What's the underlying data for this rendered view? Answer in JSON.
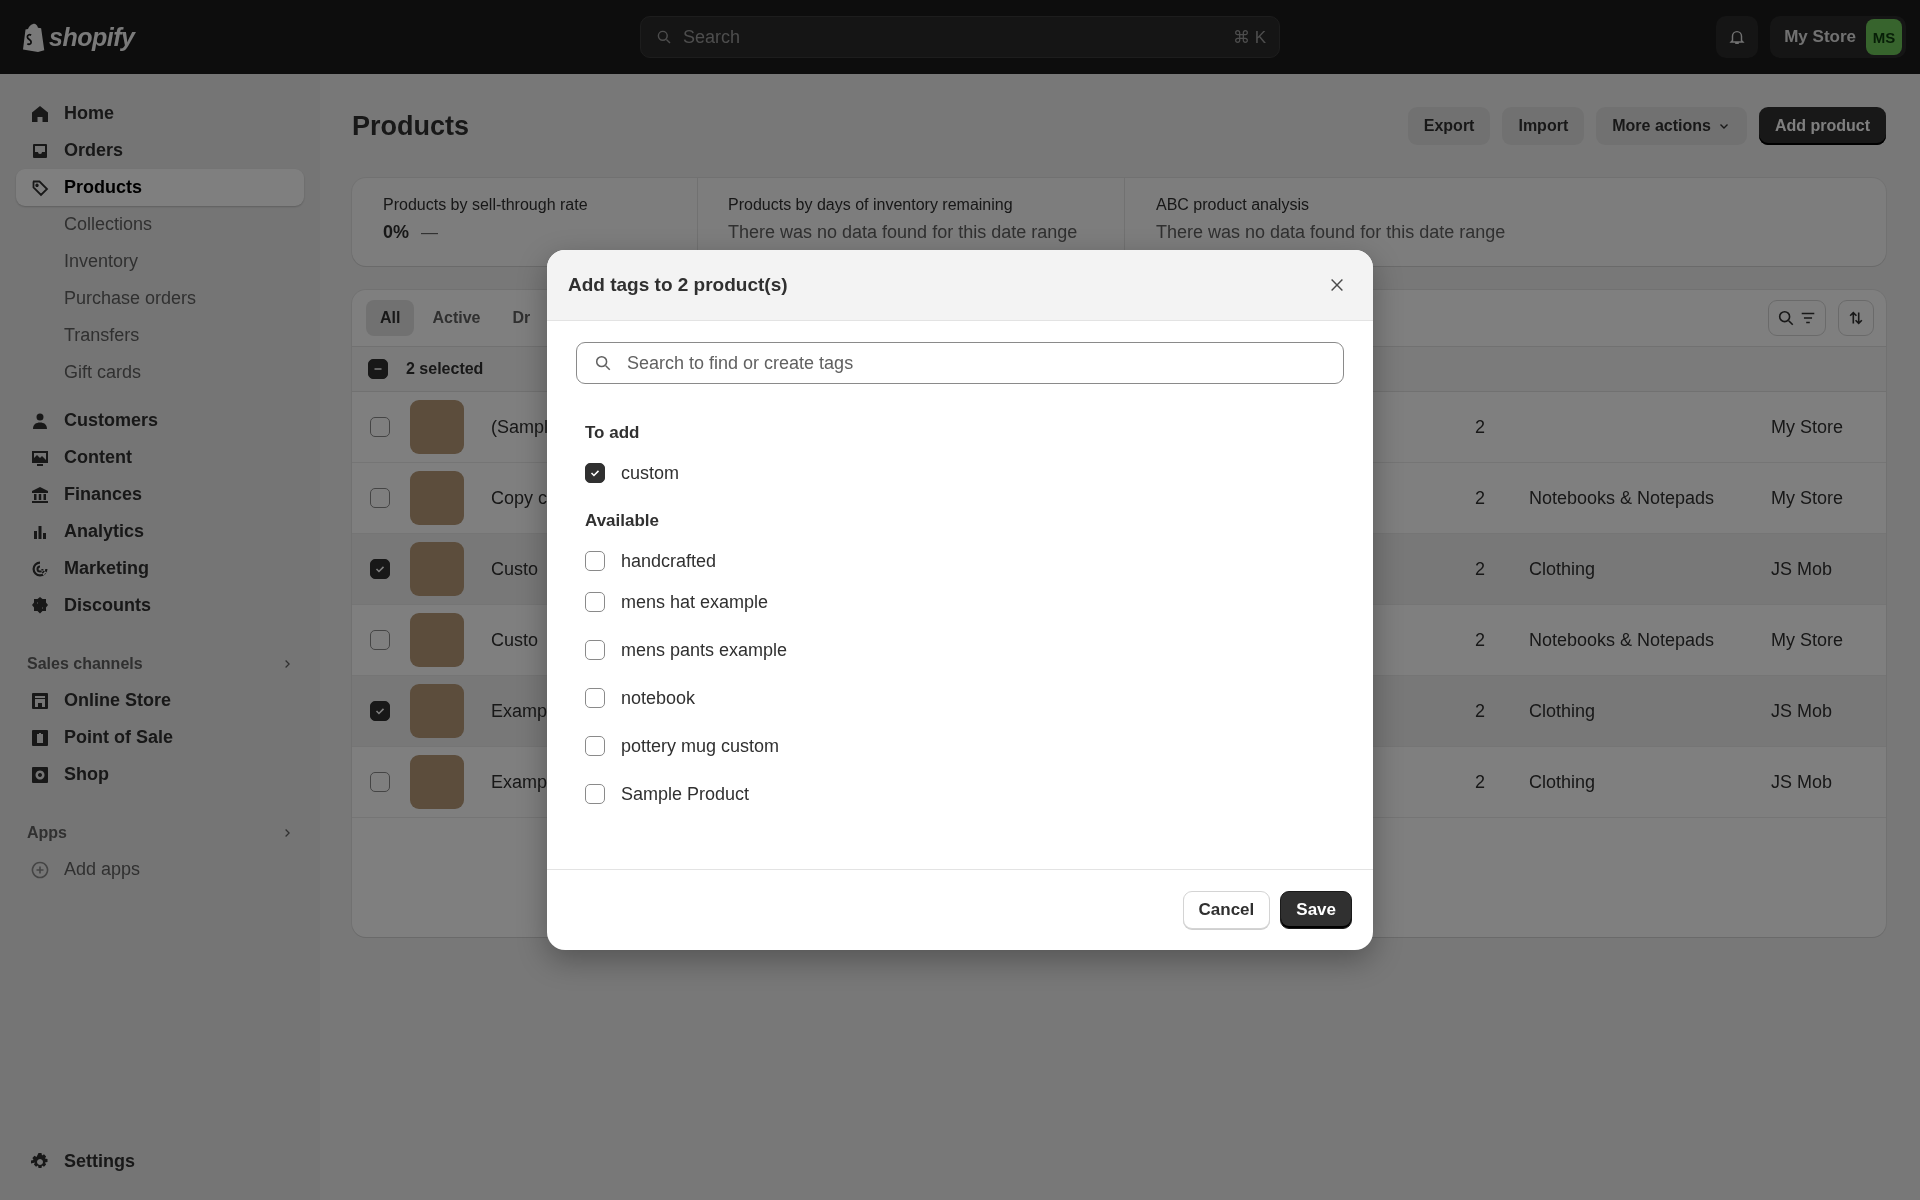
{
  "topbar": {
    "logo": "shopify",
    "search": {
      "placeholder": "Search",
      "shortcut": "⌘ K"
    },
    "store": {
      "name": "My Store",
      "initials": "MS"
    }
  },
  "sidebar": {
    "nav": [
      {
        "label": "Home",
        "selected": false
      },
      {
        "label": "Orders",
        "selected": false
      },
      {
        "label": "Products",
        "selected": true,
        "children": [
          {
            "label": "Collections",
            "selected": false
          },
          {
            "label": "Inventory",
            "selected": false
          },
          {
            "label": "Purchase orders",
            "selected": false
          },
          {
            "label": "Transfers",
            "selected": false
          },
          {
            "label": "Gift cards",
            "selected": false
          }
        ]
      },
      {
        "label": "Customers",
        "selected": false
      },
      {
        "label": "Content",
        "selected": false
      },
      {
        "label": "Finances",
        "selected": false
      },
      {
        "label": "Analytics",
        "selected": false
      },
      {
        "label": "Marketing",
        "selected": false
      },
      {
        "label": "Discounts",
        "selected": false
      }
    ],
    "sections": [
      {
        "title": "Sales channels",
        "items": [
          {
            "label": "Online Store",
            "selected": false
          },
          {
            "label": "Point of Sale",
            "selected": false
          },
          {
            "label": "Shop",
            "selected": false
          }
        ]
      },
      {
        "title": "Apps",
        "items": [
          {
            "label": "Add apps",
            "selected": false,
            "kind": "muted"
          }
        ]
      }
    ],
    "footer": [
      {
        "label": "Settings",
        "selected": false
      }
    ]
  },
  "page": {
    "title": "Products",
    "actions": [
      {
        "label": "Export",
        "kind": "plain"
      },
      {
        "label": "Import",
        "kind": "plain"
      },
      {
        "label": "More actions",
        "kind": "menu"
      },
      {
        "label": "Add product",
        "kind": "primary"
      }
    ]
  },
  "analytics": [
    {
      "kind": "metric",
      "title": "Products by sell-through rate",
      "value": "0%",
      "trend": "—"
    },
    {
      "kind": "empty",
      "title": "Products by days of inventory remaining",
      "note": "There was no data found for this date range"
    },
    {
      "kind": "empty",
      "title": "ABC product analysis",
      "note": "There was no data found for this date range"
    }
  ],
  "table": {
    "tabs": [
      {
        "label": "All",
        "selected": true
      },
      {
        "label": "Active",
        "selected": false
      },
      {
        "label": "Dr",
        "selected": false
      }
    ],
    "selection": {
      "label": "2 selected",
      "indeterminate": true
    },
    "rows": [
      {
        "name": "(Sampl",
        "count": "2",
        "vendor": "My Store",
        "checked": false
      },
      {
        "name": "Copy c",
        "count": "2",
        "category": "Notebooks & Notepads",
        "vendor": "My Store",
        "checked": false
      },
      {
        "name": "Custo",
        "count": "2",
        "category": "Clothing",
        "vendor": "JS Mob",
        "checked": true
      },
      {
        "name": "Custo",
        "count": "2",
        "category": "Notebooks & Notepads",
        "vendor": "My Store",
        "checked": false
      },
      {
        "name": "Examp",
        "count": "2",
        "category": "Clothing",
        "vendor": "JS Mob",
        "checked": true
      },
      {
        "name": "Examp",
        "count": "2",
        "category": "Clothing",
        "vendor": "JS Mob",
        "checked": false
      }
    ]
  },
  "modal": {
    "title": "Add tags to 2 product(s)",
    "search": {
      "placeholder": "Search to find or create tags"
    },
    "groups": [
      {
        "title": "To add",
        "tags": [
          {
            "label": "custom",
            "checked": true
          }
        ]
      },
      {
        "title": "Available",
        "tags": [
          {
            "label": "handcrafted",
            "checked": false
          },
          {
            "label": "mens hat example",
            "checked": false
          },
          {
            "label": "mens pants example",
            "checked": false
          },
          {
            "label": "notebook",
            "checked": false
          },
          {
            "label": "pottery mug custom",
            "checked": false
          },
          {
            "label": "Sample Product",
            "checked": false
          }
        ]
      }
    ],
    "buttons": [
      {
        "label": "Cancel",
        "kind": "secondary"
      },
      {
        "label": "Save",
        "kind": "primary"
      }
    ]
  }
}
